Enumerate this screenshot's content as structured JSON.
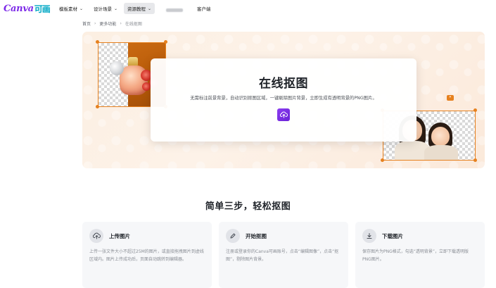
{
  "brand": {
    "latin": "Canva",
    "cn": "可画"
  },
  "nav": {
    "items": [
      {
        "label": "模板素材",
        "has_dropdown": true,
        "active": false
      },
      {
        "label": "设计场景",
        "has_dropdown": true,
        "active": false
      },
      {
        "label": "资源教程",
        "has_dropdown": true,
        "active": true
      },
      {
        "label": "客户端",
        "has_dropdown": false,
        "active": false
      }
    ]
  },
  "breadcrumb": {
    "home": "首页",
    "more": "更多功能",
    "current": "在线抠图",
    "separator": "›"
  },
  "hero": {
    "title": "在线抠图",
    "description": "无需标注前景背景，自动识别抠图区域，一键剔除图片背景，立即生成有透明背景的PNG图片。",
    "upload_icon": "cloud-upload-icon",
    "accent_color": "#7d2ae8",
    "frame_color": "#e6811f"
  },
  "steps": {
    "title": "简单三步，轻松抠图",
    "cards": [
      {
        "icon": "cloud-upload-icon",
        "title": "上传图片",
        "description": "上传一张文件大小不超过25M的图片，或直接拖拽图片到虚线区域内。图片上传成功后，页面自动跳转到编辑器。"
      },
      {
        "icon": "pencil-icon",
        "title": "开始抠图",
        "description": "注册或登录你的Canva可画账号，点击“编辑图像”，点击“抠图”，剔除图片背景。"
      },
      {
        "icon": "download-icon",
        "title": "下载图片",
        "description": "保存图片为PNG格式，勾选“透明背景”，立即下载透明版PNG图片。"
      }
    ]
  }
}
